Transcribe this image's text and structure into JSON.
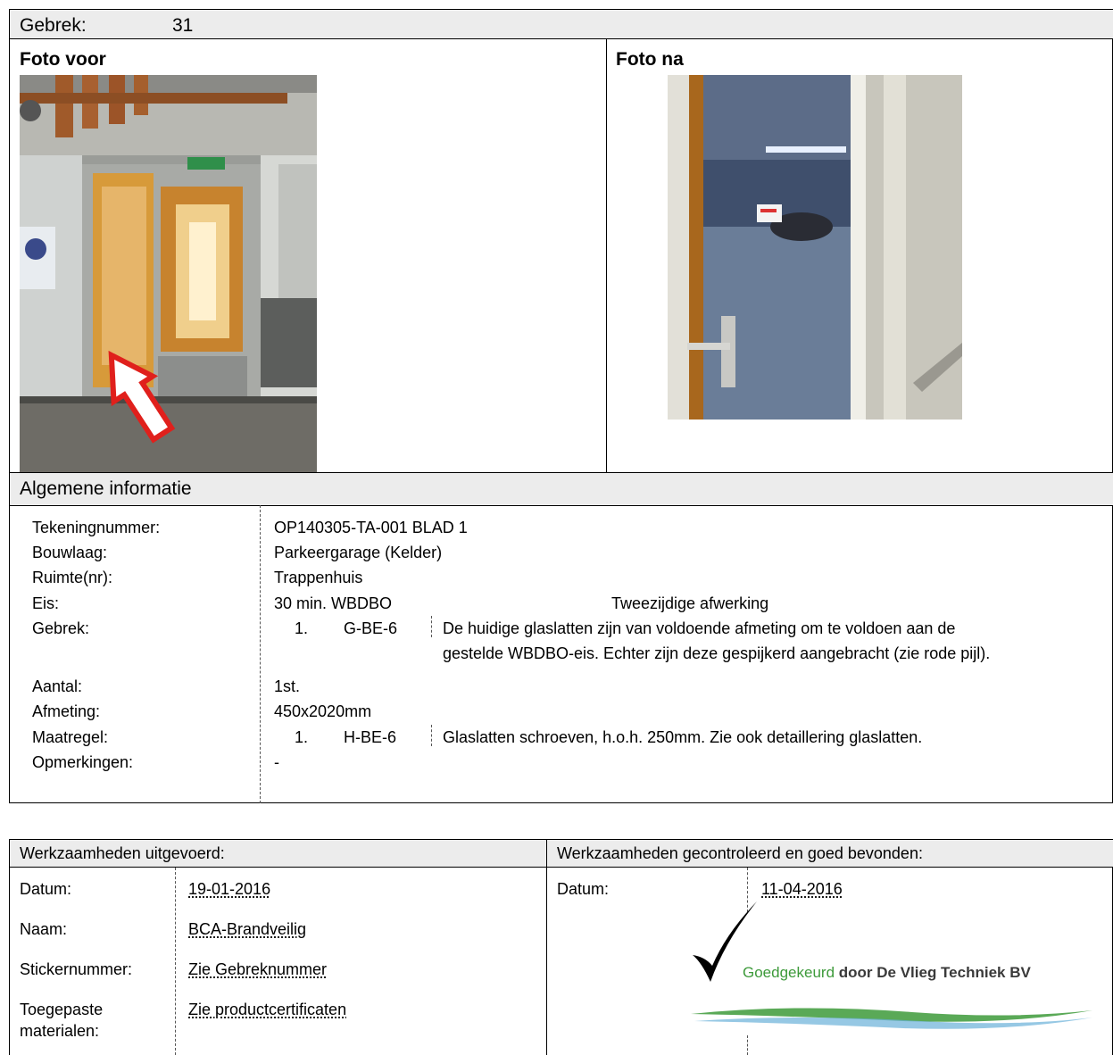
{
  "defect": {
    "label": "Gebrek:",
    "number": "31"
  },
  "photos": {
    "before_label": "Foto voor",
    "after_label": "Foto na"
  },
  "general": {
    "title": "Algemene informatie",
    "rows": {
      "drawing_label": "Tekeningnummer:",
      "drawing_value": "OP140305-TA-001 BLAD 1",
      "level_label": "Bouwlaag:",
      "level_value": "Parkeergarage (Kelder)",
      "room_label": "Ruimte(nr):",
      "room_value": "Trappenhuis",
      "req_label": "Eis:",
      "req_value": "30 min. WBDBO",
      "req_extra": "Tweezijdige afwerking",
      "defect_label": "Gebrek:",
      "defect_num": "1.",
      "defect_code": "G-BE-6",
      "defect_text_1": "De huidige glaslatten zijn van voldoende afmeting om te voldoen aan de",
      "defect_text_2": "gestelde WBDBO-eis. Echter zijn deze gespijkerd aangebracht (zie rode pijl).",
      "count_label": "Aantal:",
      "count_value": "1st.",
      "size_label": "Afmeting:",
      "size_value": "450x2020mm",
      "measure_label": "Maatregel:",
      "measure_num": "1.",
      "measure_code": "H-BE-6",
      "measure_text": "Glaslatten schroeven, h.o.h. 250mm. Zie ook detaillering glaslatten.",
      "remarks_label": "Opmerkingen:",
      "remarks_value": "-"
    }
  },
  "executed": {
    "title": "Werkzaamheden uitgevoerd:",
    "date_label": "Datum:",
    "date_value": "19-01-2016",
    "name_label": "Naam:",
    "name_value": "BCA-Brandveilig",
    "sticker_label": "Stickernummer:",
    "sticker_value": "Zie Gebreknummer",
    "materials_label_1": "Toegepaste",
    "materials_label_2": "materialen:",
    "materials_value": "Zie productcertificaten"
  },
  "checked": {
    "title": "Werkzaamheden gecontroleerd en goed bevonden:",
    "date_label": "Datum:",
    "date_value": "11-04-2016",
    "stamp_green": "Goedgekeurd",
    "stamp_dark": "door De Vlieg Techniek BV"
  },
  "colors": {
    "header_bg": "#ececec",
    "arrow": "#e0201c",
    "stamp_green": "#3d9a3a",
    "stamp_dark": "#3a3a3a"
  }
}
